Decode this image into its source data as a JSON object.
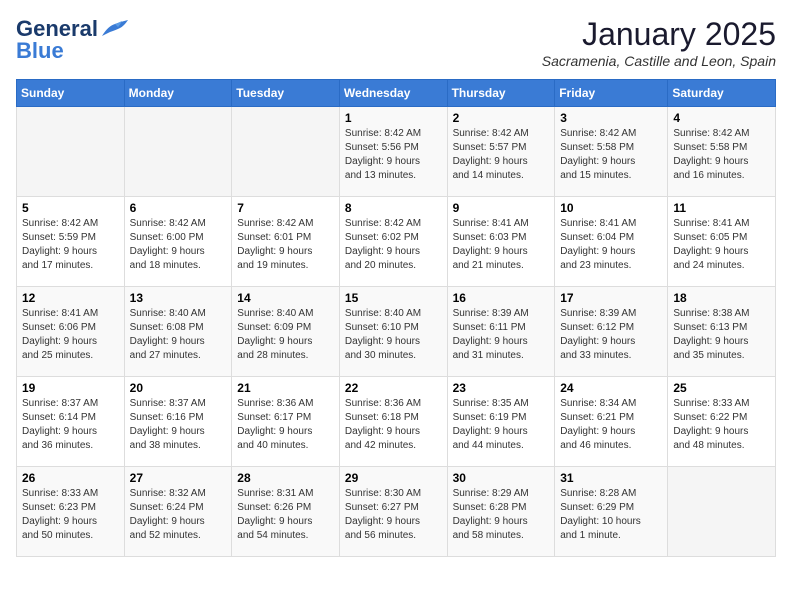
{
  "logo": {
    "general": "General",
    "blue": "Blue"
  },
  "header": {
    "title": "January 2025",
    "subtitle": "Sacramenia, Castille and Leon, Spain"
  },
  "weekdays": [
    "Sunday",
    "Monday",
    "Tuesday",
    "Wednesday",
    "Thursday",
    "Friday",
    "Saturday"
  ],
  "weeks": [
    {
      "days": [
        {
          "num": "",
          "info": ""
        },
        {
          "num": "",
          "info": ""
        },
        {
          "num": "",
          "info": ""
        },
        {
          "num": "1",
          "info": "Sunrise: 8:42 AM\nSunset: 5:56 PM\nDaylight: 9 hours\nand 13 minutes."
        },
        {
          "num": "2",
          "info": "Sunrise: 8:42 AM\nSunset: 5:57 PM\nDaylight: 9 hours\nand 14 minutes."
        },
        {
          "num": "3",
          "info": "Sunrise: 8:42 AM\nSunset: 5:58 PM\nDaylight: 9 hours\nand 15 minutes."
        },
        {
          "num": "4",
          "info": "Sunrise: 8:42 AM\nSunset: 5:58 PM\nDaylight: 9 hours\nand 16 minutes."
        }
      ]
    },
    {
      "days": [
        {
          "num": "5",
          "info": "Sunrise: 8:42 AM\nSunset: 5:59 PM\nDaylight: 9 hours\nand 17 minutes."
        },
        {
          "num": "6",
          "info": "Sunrise: 8:42 AM\nSunset: 6:00 PM\nDaylight: 9 hours\nand 18 minutes."
        },
        {
          "num": "7",
          "info": "Sunrise: 8:42 AM\nSunset: 6:01 PM\nDaylight: 9 hours\nand 19 minutes."
        },
        {
          "num": "8",
          "info": "Sunrise: 8:42 AM\nSunset: 6:02 PM\nDaylight: 9 hours\nand 20 minutes."
        },
        {
          "num": "9",
          "info": "Sunrise: 8:41 AM\nSunset: 6:03 PM\nDaylight: 9 hours\nand 21 minutes."
        },
        {
          "num": "10",
          "info": "Sunrise: 8:41 AM\nSunset: 6:04 PM\nDaylight: 9 hours\nand 23 minutes."
        },
        {
          "num": "11",
          "info": "Sunrise: 8:41 AM\nSunset: 6:05 PM\nDaylight: 9 hours\nand 24 minutes."
        }
      ]
    },
    {
      "days": [
        {
          "num": "12",
          "info": "Sunrise: 8:41 AM\nSunset: 6:06 PM\nDaylight: 9 hours\nand 25 minutes."
        },
        {
          "num": "13",
          "info": "Sunrise: 8:40 AM\nSunset: 6:08 PM\nDaylight: 9 hours\nand 27 minutes."
        },
        {
          "num": "14",
          "info": "Sunrise: 8:40 AM\nSunset: 6:09 PM\nDaylight: 9 hours\nand 28 minutes."
        },
        {
          "num": "15",
          "info": "Sunrise: 8:40 AM\nSunset: 6:10 PM\nDaylight: 9 hours\nand 30 minutes."
        },
        {
          "num": "16",
          "info": "Sunrise: 8:39 AM\nSunset: 6:11 PM\nDaylight: 9 hours\nand 31 minutes."
        },
        {
          "num": "17",
          "info": "Sunrise: 8:39 AM\nSunset: 6:12 PM\nDaylight: 9 hours\nand 33 minutes."
        },
        {
          "num": "18",
          "info": "Sunrise: 8:38 AM\nSunset: 6:13 PM\nDaylight: 9 hours\nand 35 minutes."
        }
      ]
    },
    {
      "days": [
        {
          "num": "19",
          "info": "Sunrise: 8:37 AM\nSunset: 6:14 PM\nDaylight: 9 hours\nand 36 minutes."
        },
        {
          "num": "20",
          "info": "Sunrise: 8:37 AM\nSunset: 6:16 PM\nDaylight: 9 hours\nand 38 minutes."
        },
        {
          "num": "21",
          "info": "Sunrise: 8:36 AM\nSunset: 6:17 PM\nDaylight: 9 hours\nand 40 minutes."
        },
        {
          "num": "22",
          "info": "Sunrise: 8:36 AM\nSunset: 6:18 PM\nDaylight: 9 hours\nand 42 minutes."
        },
        {
          "num": "23",
          "info": "Sunrise: 8:35 AM\nSunset: 6:19 PM\nDaylight: 9 hours\nand 44 minutes."
        },
        {
          "num": "24",
          "info": "Sunrise: 8:34 AM\nSunset: 6:21 PM\nDaylight: 9 hours\nand 46 minutes."
        },
        {
          "num": "25",
          "info": "Sunrise: 8:33 AM\nSunset: 6:22 PM\nDaylight: 9 hours\nand 48 minutes."
        }
      ]
    },
    {
      "days": [
        {
          "num": "26",
          "info": "Sunrise: 8:33 AM\nSunset: 6:23 PM\nDaylight: 9 hours\nand 50 minutes."
        },
        {
          "num": "27",
          "info": "Sunrise: 8:32 AM\nSunset: 6:24 PM\nDaylight: 9 hours\nand 52 minutes."
        },
        {
          "num": "28",
          "info": "Sunrise: 8:31 AM\nSunset: 6:26 PM\nDaylight: 9 hours\nand 54 minutes."
        },
        {
          "num": "29",
          "info": "Sunrise: 8:30 AM\nSunset: 6:27 PM\nDaylight: 9 hours\nand 56 minutes."
        },
        {
          "num": "30",
          "info": "Sunrise: 8:29 AM\nSunset: 6:28 PM\nDaylight: 9 hours\nand 58 minutes."
        },
        {
          "num": "31",
          "info": "Sunrise: 8:28 AM\nSunset: 6:29 PM\nDaylight: 10 hours\nand 1 minute."
        },
        {
          "num": "",
          "info": ""
        }
      ]
    }
  ]
}
